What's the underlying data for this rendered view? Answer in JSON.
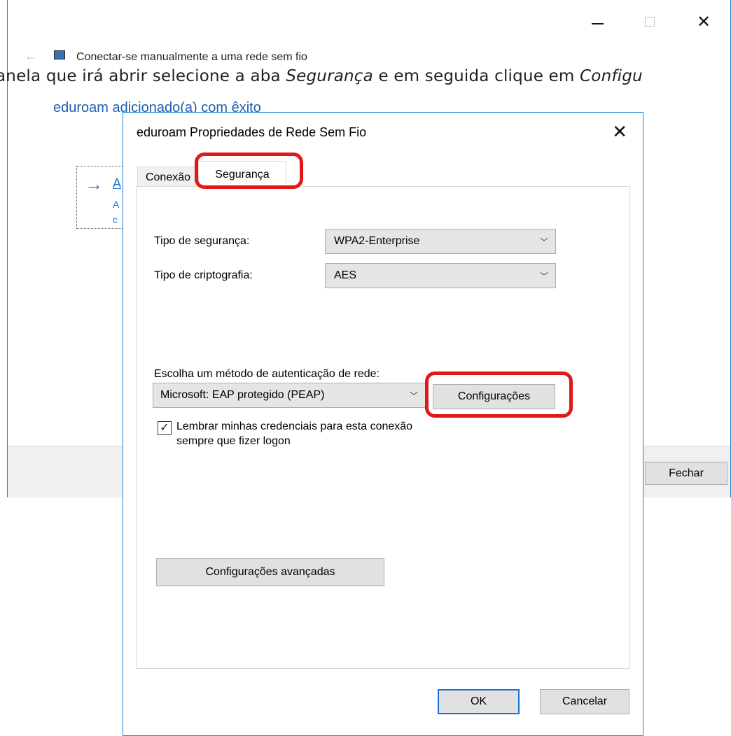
{
  "background_window": {
    "back_glyph": "←",
    "breadcrumb": "Conectar-se manualmente a uma rede sem fio",
    "added_message": "eduroam adicionado(a) com êxito",
    "link_arrow": "→",
    "link_title_partial": "A",
    "link_sub_1_partial": "A",
    "link_sub_2_partial": "c",
    "close_button": "Fechar",
    "close_glyph": "✕"
  },
  "instruction": {
    "prefix": "anela que irá abrir selecione a aba ",
    "tab_name": "Segurança",
    "middle": " e em seguida clique em ",
    "button_name": "Configu"
  },
  "dialog": {
    "title": "eduroam Propriedades de Rede Sem Fio",
    "close_glyph": "✕",
    "tabs": [
      {
        "label": "Conexão",
        "selected": false
      },
      {
        "label": "Segurança",
        "selected": true
      }
    ],
    "security_type_label": "Tipo de segurança:",
    "security_type_value": "WPA2-Enterprise",
    "encryption_type_label": "Tipo de criptografia:",
    "encryption_type_value": "AES",
    "auth_method_label": "Escolha um método de autenticação de rede:",
    "auth_method_value": "Microsoft: EAP protegido (PEAP)",
    "settings_button": "Configurações",
    "remember_checkbox_checked": true,
    "remember_line_1": "Lembrar minhas credenciais para esta conexão",
    "remember_line_2": "sempre que fizer logon",
    "advanced_button": "Configurações avançadas",
    "ok_button": "OK",
    "cancel_button": "Cancelar",
    "chevron_glyph": "﹀"
  },
  "colors": {
    "accent": "#1883d7",
    "link": "#1b73d1",
    "annotation_red": "#e21818",
    "button_face": "#e1e1e1"
  }
}
